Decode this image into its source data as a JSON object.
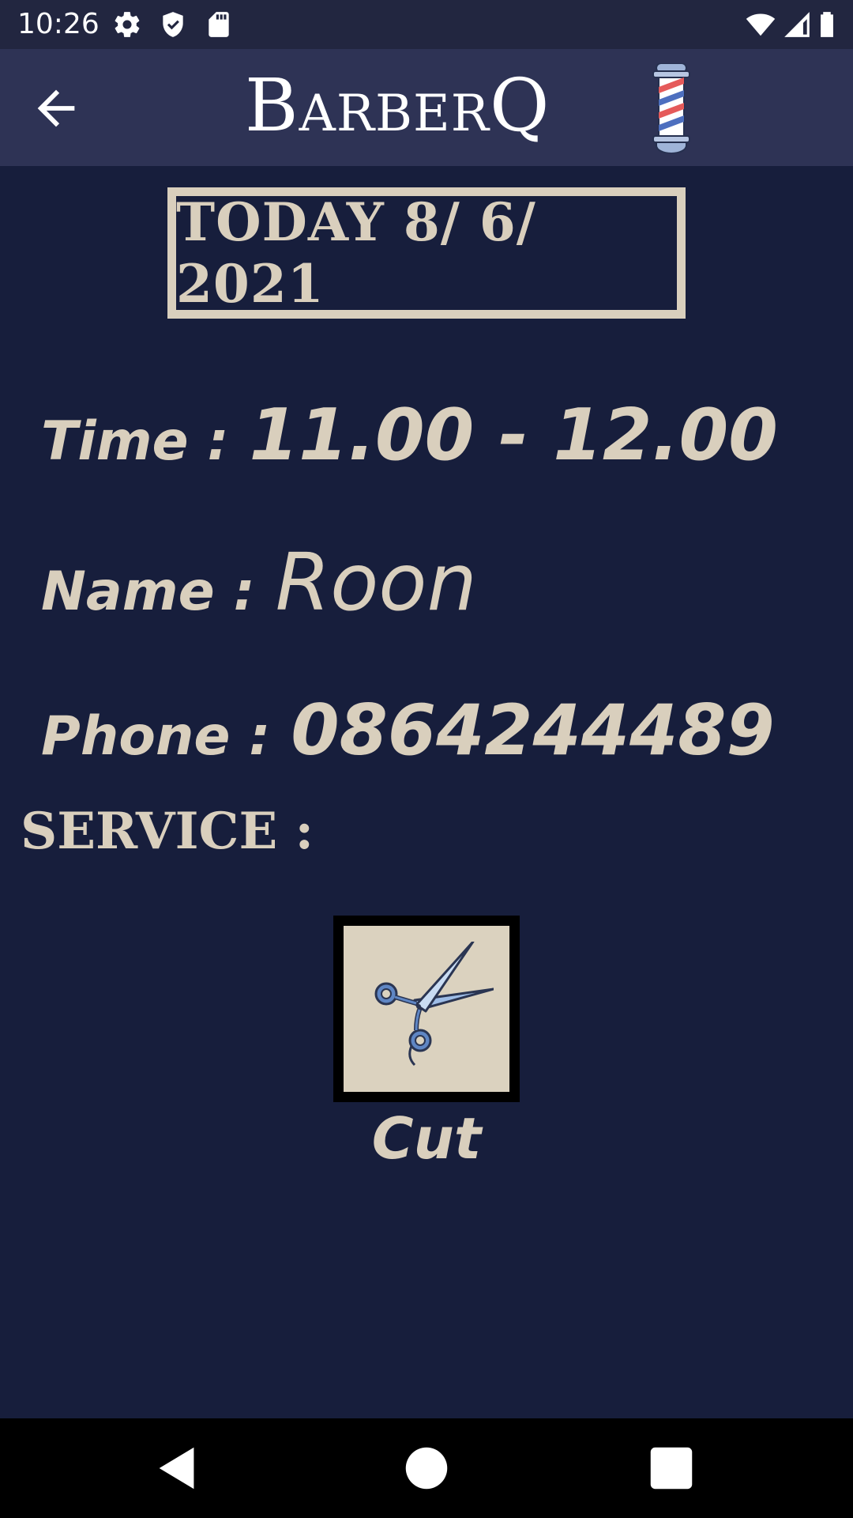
{
  "status_bar": {
    "time": "10:26",
    "icons": [
      "gear-icon",
      "shield-icon",
      "sd-card-icon",
      "wifi-icon",
      "signal-icon",
      "battery-icon"
    ]
  },
  "app_bar": {
    "title": "BarberQ",
    "back_icon": "arrow-left-icon",
    "logo_icon": "barber-pole-icon"
  },
  "booking": {
    "date": "TODAY 8/ 6/ 2021",
    "time_label": "Time :",
    "time_value": "11.00 - 12.00",
    "name_label": "Name :",
    "name_value": "Roon",
    "phone_label": "Phone :",
    "phone_value": "0864244489"
  },
  "service": {
    "heading": "SERVICE :",
    "items": [
      {
        "label": "Cut",
        "icon": "scissors-icon"
      }
    ]
  },
  "nav_bar": {
    "buttons": [
      "back-triangle-icon",
      "home-circle-icon",
      "recents-square-icon"
    ]
  },
  "colors": {
    "background": "#171e3c",
    "app_bar": "#2e3355",
    "accent": "#d9cfbd"
  }
}
